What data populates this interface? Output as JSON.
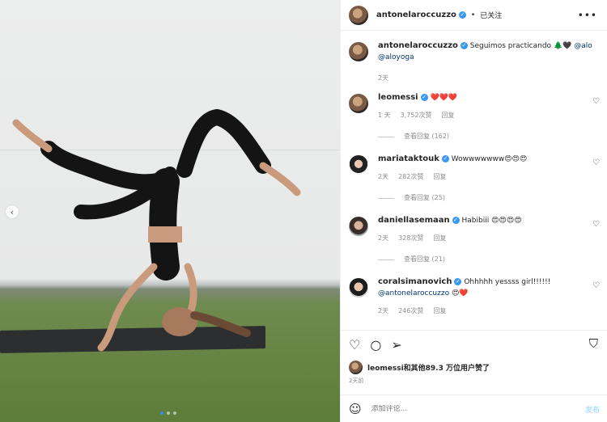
{
  "post": {
    "author": "antonelaroccuzzo",
    "follow_status": "已关注",
    "caption_text": "Seguimos practicando",
    "caption_emoji": "🌲🖤",
    "caption_tag_1": "@alo",
    "caption_tag_2": "@aloyoga",
    "caption_time": "2天"
  },
  "comments": [
    {
      "user": "leomessi",
      "text": "❤️❤️❤️",
      "time": "1 天",
      "likes": "3,752次赞",
      "reply": "回复",
      "view_replies": "查看回复 (162)"
    },
    {
      "user": "mariataktouk",
      "text": "Wowwwwwww😍😍😍",
      "time": "2天",
      "likes": "282次赞",
      "reply": "回复",
      "view_replies": "查看回复 (25)"
    },
    {
      "user": "daniellasemaan",
      "text": "Habibiii 😍😍😍😍",
      "time": "2天",
      "likes": "328次赞",
      "reply": "回复",
      "view_replies": "查看回复 (21)"
    },
    {
      "user": "coralsimanovich",
      "text": "Ohhhhh yessss girl!!!!!!",
      "mention": "@antonelaroccuzzo",
      "mention_emoji": "😍❤️",
      "time": "2天",
      "likes": "246次赞",
      "reply": "回复"
    }
  ],
  "likes_summary": "leomessi和其他89.3 万位用户赞了",
  "post_age": "2天前",
  "composer": {
    "placeholder": "添加评论...",
    "post_label": "发布"
  },
  "icons": {
    "heart": "heart-icon",
    "comment": "comment-icon",
    "share": "share-icon",
    "save": "bookmark-icon",
    "emoji": "emoji-icon",
    "more": "more-icon",
    "verified": "verified-icon",
    "prev": "chevron-left-icon"
  },
  "colors": {
    "verified": "#3897f0",
    "link": "#00376b",
    "post_disabled": "#b2dffc"
  }
}
